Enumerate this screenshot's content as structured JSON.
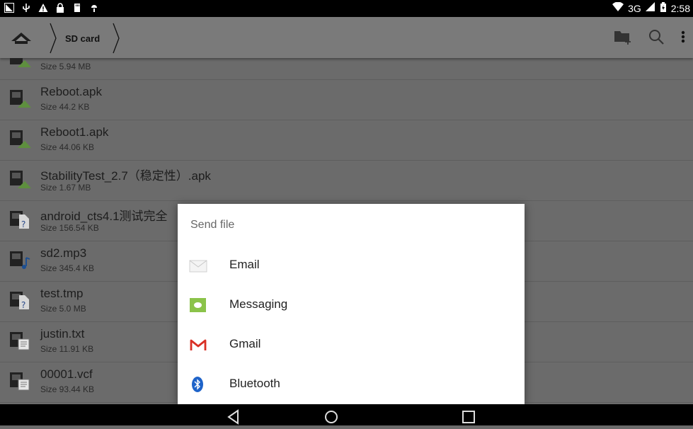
{
  "status_bar": {
    "network": "3G",
    "time": "2:58",
    "left_icons": [
      "screenshot-icon",
      "usb-icon",
      "warning-icon",
      "lock-icon",
      "sd-icon",
      "android-debug-icon"
    ]
  },
  "toolbar": {
    "breadcrumb": "SD card"
  },
  "files": [
    {
      "name": "",
      "size": "Size 5.94 MB",
      "type": "apk"
    },
    {
      "name": "Reboot.apk",
      "size": "Size 44.2 KB",
      "type": "apk"
    },
    {
      "name": "Reboot1.apk",
      "size": "Size 44.06 KB",
      "type": "apk"
    },
    {
      "name": "StabilityTest_2.7（稳定性）.apk",
      "size": "Size 1.67 MB",
      "type": "apk"
    },
    {
      "name": "android_cts4.1测试完全",
      "size": "Size 156.54 KB",
      "type": "unknown"
    },
    {
      "name": "sd2.mp3",
      "size": "Size 345.4 KB",
      "type": "audio"
    },
    {
      "name": "test.tmp",
      "size": "Size 5.0 MB",
      "type": "unknown"
    },
    {
      "name": "justin.txt",
      "size": "Size 11.91 KB",
      "type": "text"
    },
    {
      "name": "00001.vcf",
      "size": "Size 93.44 KB",
      "type": "text"
    }
  ],
  "dialog": {
    "title": "Send file",
    "options": [
      {
        "label": "Email",
        "icon": "email-icon"
      },
      {
        "label": "Messaging",
        "icon": "messaging-icon"
      },
      {
        "label": "Gmail",
        "icon": "gmail-icon"
      },
      {
        "label": "Bluetooth",
        "icon": "bluetooth-icon"
      }
    ]
  },
  "nav_bar": {
    "buttons": [
      "back-icon",
      "home-icon",
      "recents-icon"
    ]
  },
  "colors": {
    "dim_overlay": "#6b6b6b",
    "toolbar": "#7a7a7a",
    "status_bar": "#000000",
    "dialog_bg": "#ffffff",
    "messaging_green": "#8bc34a",
    "gmail_red": "#d93025",
    "bluetooth_blue": "#1e63c9"
  }
}
